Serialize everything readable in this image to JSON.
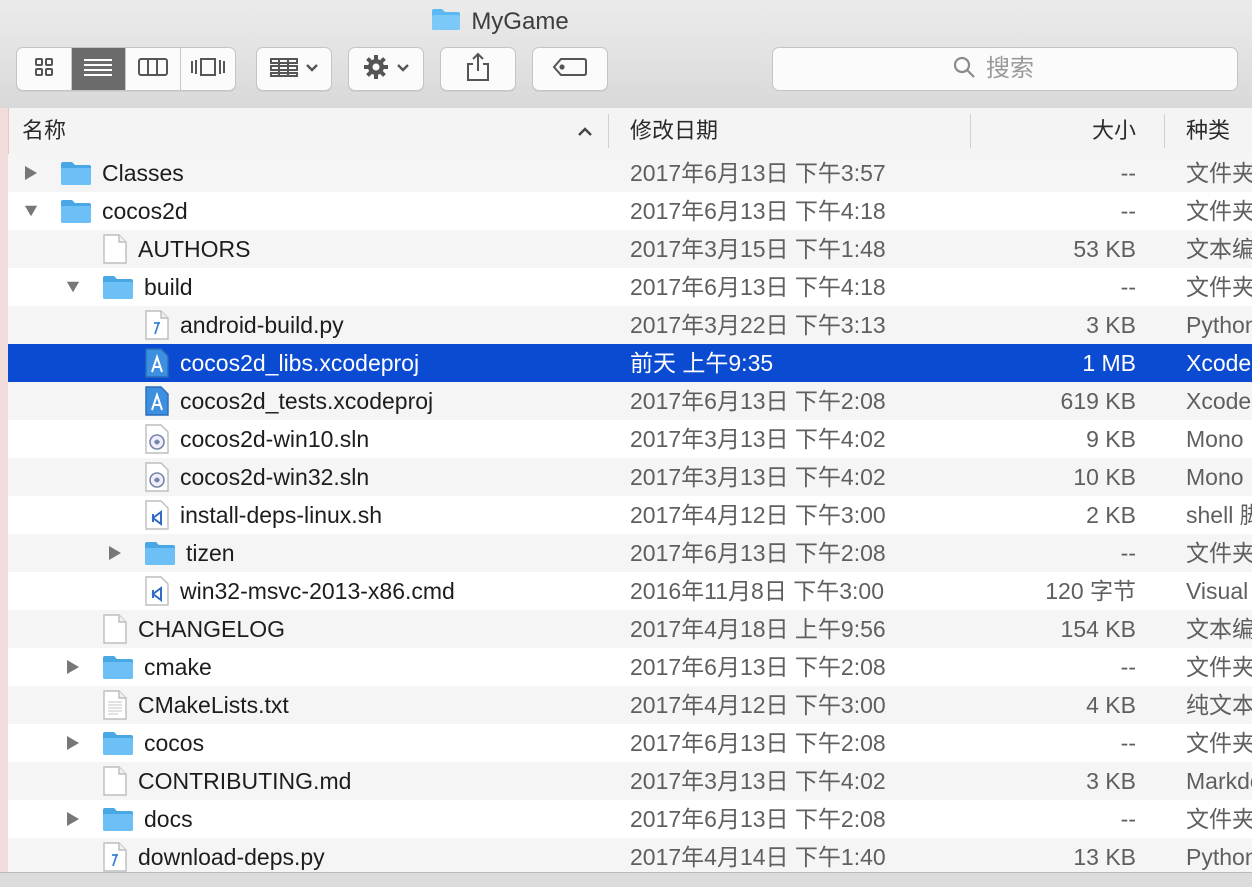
{
  "window": {
    "title": "MyGame"
  },
  "toolbar": {
    "search_placeholder": "搜索",
    "icons": [
      "view-icons-icon",
      "view-list-icon",
      "view-columns-icon",
      "view-coverflow-icon",
      "group-icon",
      "gear-icon",
      "share-icon",
      "tag-icon",
      "search-icon"
    ]
  },
  "columns": {
    "name": "名称",
    "date": "修改日期",
    "size": "大小",
    "kind": "种类"
  },
  "colors": {
    "selection": "#0b4bd1",
    "folder": "#5cb8f2",
    "stripe": "#f5f5f5"
  },
  "rows": [
    {
      "name": "Classes",
      "date": "2017年6月13日 下午3:57",
      "size": "--",
      "kind": "文件夹",
      "type": "folder",
      "level": 0,
      "disclosure": "collapsed"
    },
    {
      "name": "cocos2d",
      "date": "2017年6月13日 下午4:18",
      "size": "--",
      "kind": "文件夹",
      "type": "folder",
      "level": 0,
      "disclosure": "expanded"
    },
    {
      "name": "AUTHORS",
      "date": "2017年3月15日 下午1:48",
      "size": "53 KB",
      "kind": "文本编辑",
      "type": "doc",
      "level": 1,
      "disclosure": "none"
    },
    {
      "name": "build",
      "date": "2017年6月13日 下午4:18",
      "size": "--",
      "kind": "文件夹",
      "type": "folder",
      "level": 1,
      "disclosure": "expanded"
    },
    {
      "name": "android-build.py",
      "date": "2017年3月22日 下午3:13",
      "size": "3 KB",
      "kind": "Python",
      "type": "py",
      "level": 2,
      "disclosure": "none"
    },
    {
      "name": "cocos2d_libs.xcodeproj",
      "date": "前天 上午9:35",
      "size": "1 MB",
      "kind": "Xcode",
      "type": "xcode",
      "level": 2,
      "disclosure": "none",
      "selected": true
    },
    {
      "name": "cocos2d_tests.xcodeproj",
      "date": "2017年6月13日 下午2:08",
      "size": "619 KB",
      "kind": "Xcode",
      "type": "xcode",
      "level": 2,
      "disclosure": "none"
    },
    {
      "name": "cocos2d-win10.sln",
      "date": "2017年3月13日 下午4:02",
      "size": "9 KB",
      "kind": "Mono",
      "type": "sln",
      "level": 2,
      "disclosure": "none"
    },
    {
      "name": "cocos2d-win32.sln",
      "date": "2017年3月13日 下午4:02",
      "size": "10 KB",
      "kind": "Mono",
      "type": "sln",
      "level": 2,
      "disclosure": "none"
    },
    {
      "name": "install-deps-linux.sh",
      "date": "2017年4月12日 下午3:00",
      "size": "2 KB",
      "kind": "shell 脚本",
      "type": "vs",
      "level": 2,
      "disclosure": "none"
    },
    {
      "name": "tizen",
      "date": "2017年6月13日 下午2:08",
      "size": "--",
      "kind": "文件夹",
      "type": "folder",
      "level": 2,
      "disclosure": "collapsed"
    },
    {
      "name": "win32-msvc-2013-x86.cmd",
      "date": "2016年11月8日 下午3:00",
      "size": "120 字节",
      "kind": "Visual",
      "type": "vs",
      "level": 2,
      "disclosure": "none"
    },
    {
      "name": "CHANGELOG",
      "date": "2017年4月18日 上午9:56",
      "size": "154 KB",
      "kind": "文本编辑",
      "type": "doc",
      "level": 1,
      "disclosure": "none"
    },
    {
      "name": "cmake",
      "date": "2017年6月13日 下午2:08",
      "size": "--",
      "kind": "文件夹",
      "type": "folder",
      "level": 1,
      "disclosure": "collapsed"
    },
    {
      "name": "CMakeLists.txt",
      "date": "2017年4月12日 下午3:00",
      "size": "4 KB",
      "kind": "纯文本",
      "type": "txt",
      "level": 1,
      "disclosure": "none"
    },
    {
      "name": "cocos",
      "date": "2017年6月13日 下午2:08",
      "size": "--",
      "kind": "文件夹",
      "type": "folder",
      "level": 1,
      "disclosure": "collapsed"
    },
    {
      "name": "CONTRIBUTING.md",
      "date": "2017年3月13日 下午4:02",
      "size": "3 KB",
      "kind": "Markdown",
      "type": "doc",
      "level": 1,
      "disclosure": "none"
    },
    {
      "name": "docs",
      "date": "2017年6月13日 下午2:08",
      "size": "--",
      "kind": "文件夹",
      "type": "folder",
      "level": 1,
      "disclosure": "collapsed"
    },
    {
      "name": "download-deps.py",
      "date": "2017年4月14日 下午1:40",
      "size": "13 KB",
      "kind": "Python",
      "type": "py",
      "level": 1,
      "disclosure": "none"
    }
  ]
}
